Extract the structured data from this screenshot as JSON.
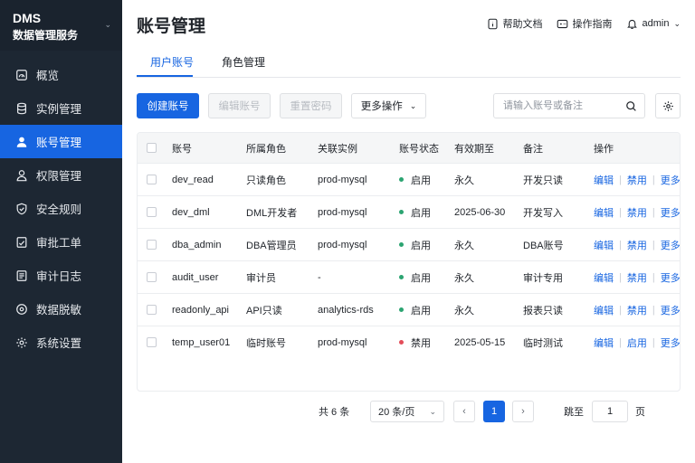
{
  "brand": {
    "title": "DMS",
    "subtitle": "数据管理服务",
    "collapse_icon": "chevron-down-icon"
  },
  "sidebar": {
    "items": [
      {
        "label": "概览",
        "icon": "dashboard-icon"
      },
      {
        "label": "实例管理",
        "icon": "database-icon"
      },
      {
        "label": "账号管理",
        "icon": "user-icon",
        "active": true
      },
      {
        "label": "权限管理",
        "icon": "user-outline-icon"
      },
      {
        "label": "安全规则",
        "icon": "shield-icon"
      },
      {
        "label": "审批工单",
        "icon": "approval-icon"
      },
      {
        "label": "审计日志",
        "icon": "log-icon"
      },
      {
        "label": "数据脱敏",
        "icon": "mask-icon"
      },
      {
        "label": "系统设置",
        "icon": "gear-icon"
      }
    ]
  },
  "header": {
    "title": "账号管理",
    "help_label": "帮助文档",
    "guide_label": "操作指南",
    "user": "admin"
  },
  "tabs": [
    {
      "label": "用户账号",
      "active": true
    },
    {
      "label": "角色管理"
    }
  ],
  "toolbar": {
    "create_label": "创建账号",
    "edit_label": "编辑账号",
    "reset_label": "重置密码",
    "more_label": "更多操作",
    "search_placeholder": "请输入账号或备注"
  },
  "table": {
    "columns": [
      "账号",
      "所属角色",
      "关联实例",
      "账号状态",
      "有效期至",
      "备注",
      "操作"
    ],
    "rows": [
      {
        "account": "dev_read",
        "role": "只读角色",
        "instance": "prod-mysql",
        "status": "启用",
        "status_color": "#2ba471",
        "expires": "永久",
        "note": "开发只读",
        "a1": "编辑",
        "a2": "禁用",
        "a3": "更多"
      },
      {
        "account": "dev_dml",
        "role": "DML开发者",
        "instance": "prod-mysql",
        "status": "启用",
        "status_color": "#2ba471",
        "expires": "2025-06-30",
        "note": "开发写入",
        "a1": "编辑",
        "a2": "禁用",
        "a3": "更多"
      },
      {
        "account": "dba_admin",
        "role": "DBA管理员",
        "instance": "prod-mysql",
        "status": "启用",
        "status_color": "#2ba471",
        "expires": "永久",
        "note": "DBA账号",
        "a1": "编辑",
        "a2": "禁用",
        "a3": "更多"
      },
      {
        "account": "audit_user",
        "role": "审计员",
        "instance": "-",
        "status": "启用",
        "status_color": "#2ba471",
        "expires": "永久",
        "note": "审计专用",
        "a1": "编辑",
        "a2": "禁用",
        "a3": "更多"
      },
      {
        "account": "readonly_api",
        "role": "API只读",
        "instance": "analytics-rds",
        "status": "启用",
        "status_color": "#2ba471",
        "expires": "永久",
        "note": "报表只读",
        "a1": "编辑",
        "a2": "禁用",
        "a3": "更多"
      },
      {
        "account": "temp_user01",
        "role": "临时账号",
        "instance": "prod-mysql",
        "status": "禁用",
        "status_color": "#e34d59",
        "expires": "2025-05-15",
        "note": "临时测试",
        "a1": "编辑",
        "a2": "启用",
        "a3": "更多"
      }
    ]
  },
  "pagination": {
    "total_label": "共 6 条",
    "page_size": "20 条/页",
    "current_page": "1",
    "jump_label": "跳至",
    "jump_value": "1",
    "page_unit": "页"
  },
  "colors": {
    "accent": "#1765e1",
    "sidebar_bg": "#1d2733",
    "enabled": "#2ba471",
    "disabled": "#e34d59"
  }
}
